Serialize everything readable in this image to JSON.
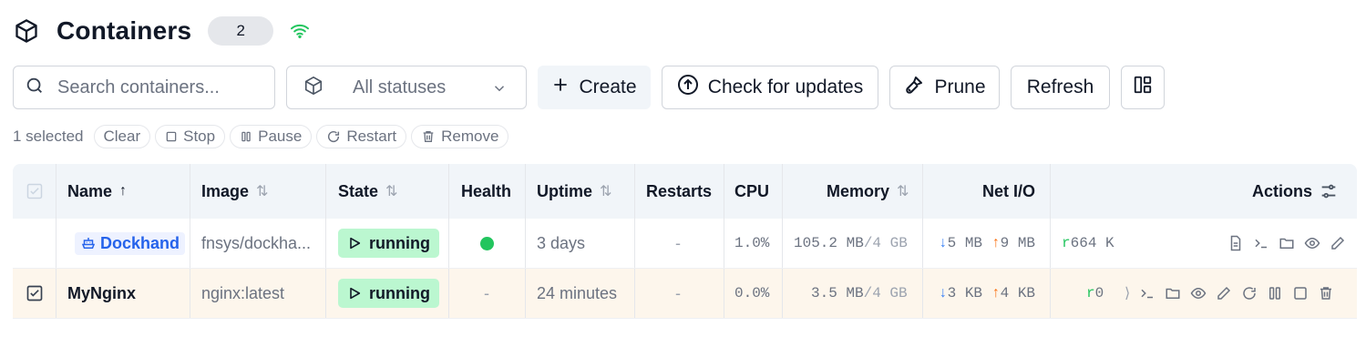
{
  "header": {
    "title": "Containers",
    "count": "2"
  },
  "toolbar": {
    "search_placeholder": "Search containers...",
    "status_filter": "All statuses",
    "create_label": "Create",
    "check_updates_label": "Check for updates",
    "prune_label": "Prune",
    "refresh_label": "Refresh"
  },
  "selection": {
    "count_text": "1 selected",
    "clear": "Clear",
    "stop": "Stop",
    "pause": "Pause",
    "restart": "Restart",
    "remove": "Remove"
  },
  "table": {
    "columns": {
      "name": "Name",
      "image": "Image",
      "state": "State",
      "health": "Health",
      "uptime": "Uptime",
      "restarts": "Restarts",
      "cpu": "CPU",
      "memory": "Memory",
      "netio": "Net I/O",
      "actions": "Actions"
    },
    "sort_active": "↑",
    "sort_neutral": "⇅",
    "rows": [
      {
        "name": "Dockhand",
        "image": "fnsys/dockha...",
        "state": "running",
        "health": "healthy",
        "uptime": "3 days",
        "restarts": "-",
        "cpu": "1.0%",
        "memory_used": "105.2 MB",
        "memory_limit": "/4 GB",
        "net_down": "5 MB",
        "net_up": "9 MB",
        "disk_prefix": "r",
        "disk": "664 K",
        "selected": false
      },
      {
        "name": "MyNginx",
        "image": "nginx:latest",
        "state": "running",
        "health": "-",
        "uptime": "24 minutes",
        "restarts": "-",
        "cpu": "0.0%",
        "memory_used": "3.5 MB",
        "memory_limit": "/4 GB",
        "net_down": "3 KB",
        "net_up": "4 KB",
        "disk_prefix": "r",
        "disk": "0",
        "selected": true
      }
    ]
  },
  "colors": {
    "running_bg": "#bbf7d0",
    "health_ok": "#22c55e",
    "selected_row": "#fdf6ec",
    "link": "#2563eb"
  }
}
